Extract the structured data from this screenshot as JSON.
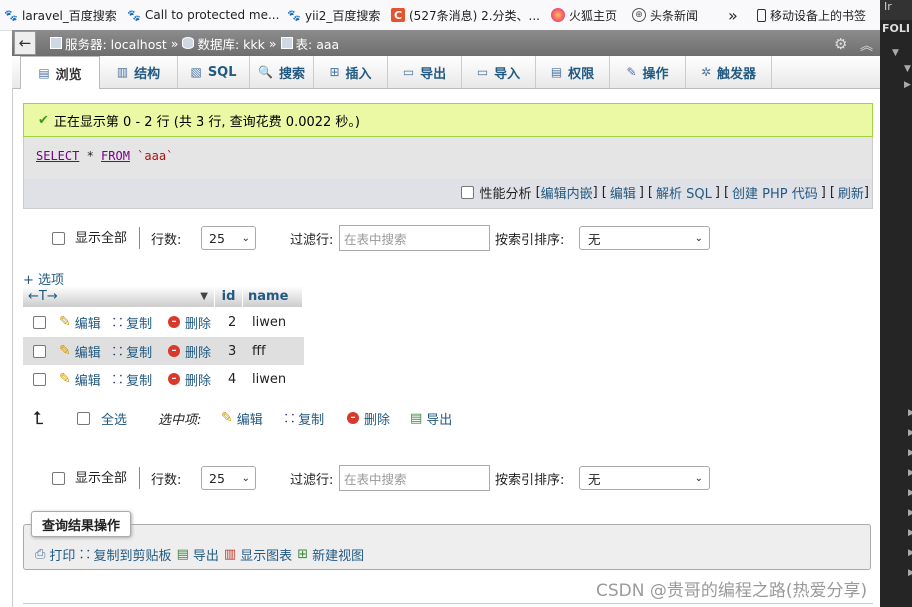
{
  "bookmarks": [
    {
      "label": "laravel_百度搜索",
      "icon": "baidu-paw-icon"
    },
    {
      "label": "Call to protected me...",
      "icon": "baidu-paw-icon"
    },
    {
      "label": "yii2_百度搜索",
      "icon": "baidu-paw-icon"
    },
    {
      "label": "(527条消息) 2.分类、...",
      "icon": "csdn-icon"
    },
    {
      "label": "火狐主页",
      "icon": "firefox-icon"
    },
    {
      "label": "头条新闻",
      "icon": "globe-icon"
    },
    {
      "label": "移动设备上的书签",
      "icon": "mobile-icon"
    }
  ],
  "bookmarks_more": "»",
  "right_panel": {
    "tab": "Ir",
    "title": "FOLI"
  },
  "breadcrumb": {
    "server_label": "服务器: localhost",
    "db_label": "数据库: kkk",
    "table_label": "表: aaa",
    "sep": "»"
  },
  "tabs": [
    {
      "label": "浏览",
      "icon": "browse-icon",
      "glyph": "▤",
      "active": true
    },
    {
      "label": "结构",
      "icon": "structure-icon",
      "glyph": "▥",
      "active": false
    },
    {
      "label": "SQL",
      "icon": "sql-icon",
      "glyph": "▧",
      "active": false
    },
    {
      "label": "搜索",
      "icon": "search-icon",
      "glyph": "🔍",
      "active": false
    },
    {
      "label": "插入",
      "icon": "insert-icon",
      "glyph": "⊞",
      "active": false
    },
    {
      "label": "导出",
      "icon": "export-icon",
      "glyph": "▭",
      "active": false
    },
    {
      "label": "导入",
      "icon": "import-icon",
      "glyph": "▭",
      "active": false
    },
    {
      "label": "权限",
      "icon": "privileges-icon",
      "glyph": "▤",
      "active": false
    },
    {
      "label": "操作",
      "icon": "wrench-icon",
      "glyph": "✎",
      "active": false
    },
    {
      "label": "触发器",
      "icon": "triggers-icon",
      "glyph": "✲",
      "active": false
    }
  ],
  "success_message": "正在显示第 0 - 2 行 (共 3 行, 查询花费 0.0022 秒。)",
  "sql": {
    "select": "SELECT",
    "rest": " * ",
    "from": "FROM",
    "table": " `aaa`"
  },
  "sql_links": {
    "profiling": "性能分析",
    "edit_inline": "编辑内嵌",
    "edit": "编辑",
    "explain": "解析 SQL",
    "create_php": "创建 PHP 代码",
    "refresh": "刷新"
  },
  "nav": {
    "show_all": "显示全部",
    "rows_label": "行数:",
    "rows_value": "25",
    "filter_label": "过滤行:",
    "filter_placeholder": "在表中搜索",
    "sort_label": "按索引排序:",
    "sort_value": "无"
  },
  "options_link": "+ 选项",
  "columns": {
    "arrows": "←T→",
    "id": "id",
    "name": "name"
  },
  "row_actions": {
    "edit": "编辑",
    "copy": "复制",
    "delete": "删除"
  },
  "rows": [
    {
      "id": "2",
      "name": "liwen"
    },
    {
      "id": "3",
      "name": "fff"
    },
    {
      "id": "4",
      "name": "liwen"
    }
  ],
  "selection": {
    "select_all": "全选",
    "with_selected": "选中项:",
    "edit": "编辑",
    "copy": "复制",
    "delete": "删除",
    "export": "导出"
  },
  "query_ops": {
    "legend": "查询结果操作",
    "print": "打印",
    "copy_clipboard": "复制到剪贴板",
    "export": "导出",
    "chart": "显示图表",
    "create_view": "新建视图"
  },
  "watermark": "CSDN @贵哥的编程之路(热爱分享)"
}
